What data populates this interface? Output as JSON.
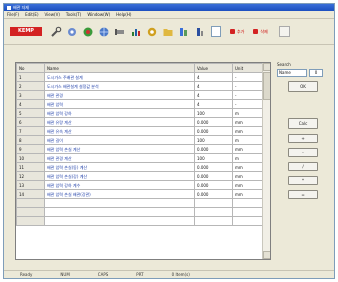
{
  "window": {
    "title": "배관 자재"
  },
  "menubar": {
    "items": [
      "File(F)",
      "Edit(E)",
      "View(V)",
      "Tools(T)",
      "Window(W)",
      "Help(H)"
    ]
  },
  "toolbar": {
    "logo_text": "KEMP",
    "buttons": [
      "wrench-icon",
      "gear-icon",
      "refresh-icon",
      "globe-icon",
      "pipe-icon",
      "chart-icon",
      "gear-icon",
      "folder-icon",
      "layers-icon",
      "ruler-icon"
    ],
    "text_btn_1": "추가",
    "text_btn_2": "삭제"
  },
  "table": {
    "columns": [
      "No",
      "Name",
      "Value",
      "Unit"
    ],
    "rows": [
      [
        "1",
        "도시가스 주배관 설계",
        "4",
        "-"
      ],
      [
        "2",
        "도시가스 배관설계 설정값 분석",
        "4",
        "-"
      ],
      [
        "3",
        "배관 관경",
        "4",
        "-"
      ],
      [
        "4",
        "배관 압력",
        "4",
        "-"
      ],
      [
        "5",
        "배관 압력 강하",
        "100",
        "m"
      ],
      [
        "6",
        "배관 유량 계산",
        "0.000",
        "mm"
      ],
      [
        "7",
        "배관 유속 계산",
        "0.000",
        "mm"
      ],
      [
        "8",
        "배관 길이",
        "100",
        "m"
      ],
      [
        "9",
        "배관 압력 손실 계산",
        "0.000",
        "mm"
      ],
      [
        "10",
        "배관 관경 계산",
        "100",
        "m"
      ],
      [
        "11",
        "배관 압력 손실(동) 계산",
        "0.000",
        "mm"
      ],
      [
        "12",
        "배관 압력 손실(강) 계산",
        "0.000",
        "mm"
      ],
      [
        "13",
        "배관 압력 강하 계수",
        "0.000",
        "mm"
      ],
      [
        "14",
        "배관 압력 손실 배관(강관)",
        "0.000",
        "mm"
      ],
      [
        "",
        "",
        "",
        ""
      ],
      [
        "",
        "",
        "",
        ""
      ],
      [
        "",
        "",
        "",
        ""
      ]
    ]
  },
  "side": {
    "label": "Search",
    "combo_value": "Name",
    "spin_value": "0",
    "search_btn": "OK",
    "group_buttons": [
      "Calc",
      "+",
      "-",
      "/",
      "*",
      "="
    ]
  },
  "statusbar": {
    "items": [
      "Ready",
      "NUM",
      "CAPS",
      "PRT",
      "0 Item(s)"
    ]
  },
  "colors": {
    "logo": "#d32222",
    "title_bar": "#1c4fbf",
    "window_bg": "#ece9d8"
  }
}
